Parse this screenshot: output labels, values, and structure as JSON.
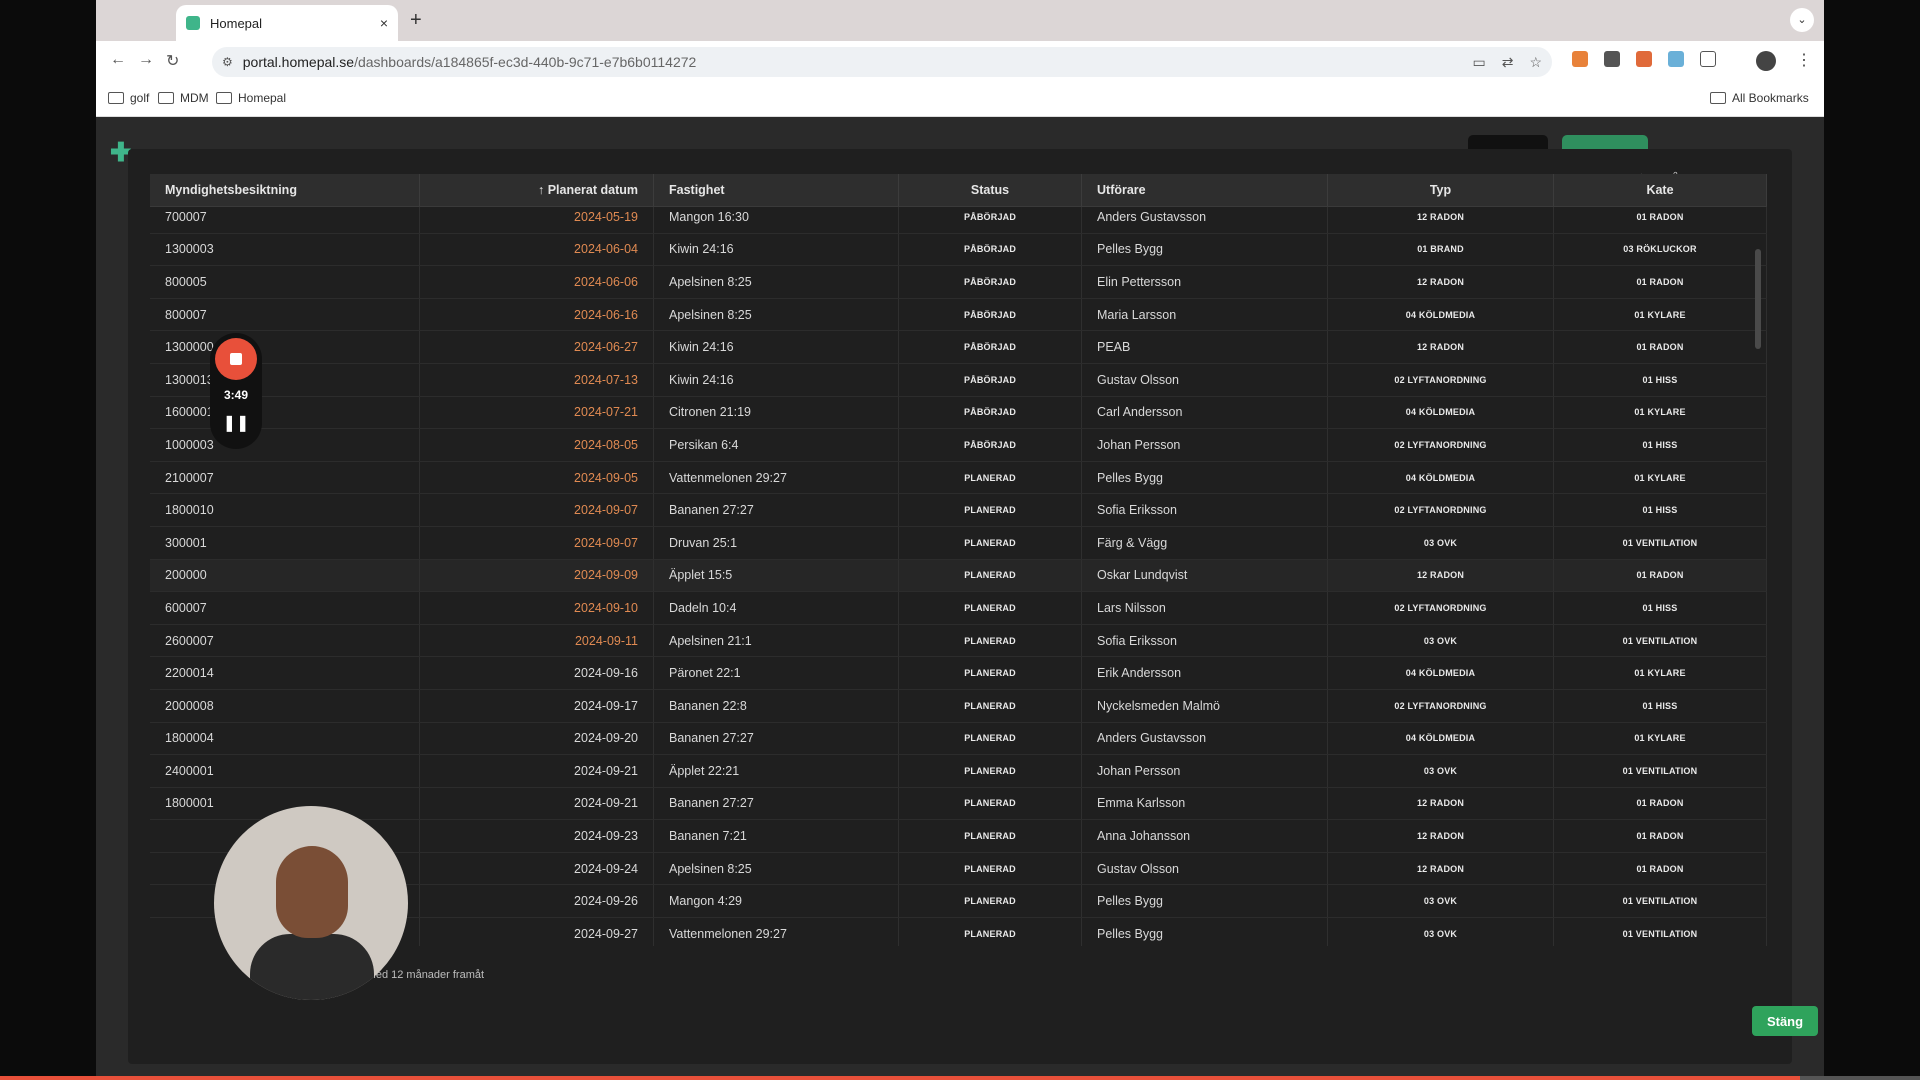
{
  "browser": {
    "tab_title": "Homepal",
    "tab_close": "×",
    "new_tab": "+",
    "url_domain": "portal.homepal.se",
    "url_path": "/dashboards/a184865f-ec3d-440b-9c71-e7b6b0114272",
    "bookmarks": [
      "golf",
      "MDM",
      "Homepal"
    ],
    "all_bookmarks": "All Bookmarks"
  },
  "recorder": {
    "time": "3:49"
  },
  "table": {
    "headers": [
      "Myndighetsbesiktning",
      "Planerat datum",
      "Fastighet",
      "Status",
      "Utförare",
      "Typ",
      "Kate"
    ],
    "sort_arrow": "↑",
    "rows": [
      {
        "id": "700007",
        "date": "2024-05-19",
        "overdue": true,
        "property": "Mangon 16:30",
        "status": "PÅBÖRJAD",
        "contractor": "Anders Gustavsson",
        "type": "12 RADON",
        "cat": "01 RADON"
      },
      {
        "id": "1300003",
        "date": "2024-06-04",
        "overdue": true,
        "property": "Kiwin 24:16",
        "status": "PÅBÖRJAD",
        "contractor": "Pelles Bygg",
        "type": "01 BRAND",
        "cat": "03 RÖKLUCKOR"
      },
      {
        "id": "800005",
        "date": "2024-06-06",
        "overdue": true,
        "property": "Apelsinen 8:25",
        "status": "PÅBÖRJAD",
        "contractor": "Elin Pettersson",
        "type": "12 RADON",
        "cat": "01 RADON"
      },
      {
        "id": "800007",
        "date": "2024-06-16",
        "overdue": true,
        "property": "Apelsinen 8:25",
        "status": "PÅBÖRJAD",
        "contractor": "Maria Larsson",
        "type": "04 KÖLDMEDIA",
        "cat": "01 KYLARE"
      },
      {
        "id": "1300000",
        "date": "2024-06-27",
        "overdue": true,
        "property": "Kiwin 24:16",
        "status": "PÅBÖRJAD",
        "contractor": "PEAB",
        "type": "12 RADON",
        "cat": "01 RADON"
      },
      {
        "id": "1300013",
        "date": "2024-07-13",
        "overdue": true,
        "property": "Kiwin 24:16",
        "status": "PÅBÖRJAD",
        "contractor": "Gustav Olsson",
        "type": "02 LYFTANORDNING",
        "cat": "01 HISS"
      },
      {
        "id": "1600001",
        "date": "2024-07-21",
        "overdue": true,
        "property": "Citronen 21:19",
        "status": "PÅBÖRJAD",
        "contractor": "Carl Andersson",
        "type": "04 KÖLDMEDIA",
        "cat": "01 KYLARE"
      },
      {
        "id": "1000003",
        "date": "2024-08-05",
        "overdue": true,
        "property": "Persikan 6:4",
        "status": "PÅBÖRJAD",
        "contractor": "Johan Persson",
        "type": "02 LYFTANORDNING",
        "cat": "01 HISS"
      },
      {
        "id": "2100007",
        "date": "2024-09-05",
        "overdue": true,
        "property": "Vattenmelonen 29:27",
        "status": "PLANERAD",
        "contractor": "Pelles Bygg",
        "type": "04 KÖLDMEDIA",
        "cat": "01 KYLARE"
      },
      {
        "id": "1800010",
        "date": "2024-09-07",
        "overdue": true,
        "property": "Bananen 27:27",
        "status": "PLANERAD",
        "contractor": "Sofia Eriksson",
        "type": "02 LYFTANORDNING",
        "cat": "01 HISS"
      },
      {
        "id": "300001",
        "date": "2024-09-07",
        "overdue": true,
        "property": "Druvan 25:1",
        "status": "PLANERAD",
        "contractor": "Färg & Vägg",
        "type": "03 OVK",
        "cat": "01 VENTILATION"
      },
      {
        "id": "200000",
        "date": "2024-09-09",
        "overdue": true,
        "property": "Äpplet 15:5",
        "status": "PLANERAD",
        "contractor": "Oskar Lundqvist",
        "type": "12 RADON",
        "cat": "01 RADON"
      },
      {
        "id": "600007",
        "date": "2024-09-10",
        "overdue": true,
        "property": "Dadeln 10:4",
        "status": "PLANERAD",
        "contractor": "Lars Nilsson",
        "type": "02 LYFTANORDNING",
        "cat": "01 HISS"
      },
      {
        "id": "2600007",
        "date": "2024-09-11",
        "overdue": true,
        "property": "Apelsinen 21:1",
        "status": "PLANERAD",
        "contractor": "Sofia Eriksson",
        "type": "03 OVK",
        "cat": "01 VENTILATION"
      },
      {
        "id": "2200014",
        "date": "2024-09-16",
        "overdue": false,
        "property": "Päronet 22:1",
        "status": "PLANERAD",
        "contractor": "Erik Andersson",
        "type": "04 KÖLDMEDIA",
        "cat": "01 KYLARE"
      },
      {
        "id": "2000008",
        "date": "2024-09-17",
        "overdue": false,
        "property": "Bananen 22:8",
        "status": "PLANERAD",
        "contractor": "Nyckelsmeden Malmö",
        "type": "02 LYFTANORDNING",
        "cat": "01 HISS"
      },
      {
        "id": "1800004",
        "date": "2024-09-20",
        "overdue": false,
        "property": "Bananen 27:27",
        "status": "PLANERAD",
        "contractor": "Anders Gustavsson",
        "type": "04 KÖLDMEDIA",
        "cat": "01 KYLARE"
      },
      {
        "id": "2400001",
        "date": "2024-09-21",
        "overdue": false,
        "property": "Äpplet 22:21",
        "status": "PLANERAD",
        "contractor": "Johan Persson",
        "type": "03 OVK",
        "cat": "01 VENTILATION"
      },
      {
        "id": "1800001",
        "date": "2024-09-21",
        "overdue": false,
        "property": "Bananen 27:27",
        "status": "PLANERAD",
        "contractor": "Emma Karlsson",
        "type": "12 RADON",
        "cat": "01 RADON"
      },
      {
        "id": "",
        "date": "2024-09-23",
        "overdue": false,
        "property": "Bananen 7:21",
        "status": "PLANERAD",
        "contractor": "Anna Johansson",
        "type": "12 RADON",
        "cat": "01 RADON"
      },
      {
        "id": "",
        "date": "2024-09-24",
        "overdue": false,
        "property": "Apelsinen 8:25",
        "status": "PLANERAD",
        "contractor": "Gustav Olsson",
        "type": "12 RADON",
        "cat": "01 RADON"
      },
      {
        "id": "",
        "date": "2024-09-26",
        "overdue": false,
        "property": "Mangon 4:29",
        "status": "PLANERAD",
        "contractor": "Pelles Bygg",
        "type": "03 OVK",
        "cat": "01 VENTILATION"
      },
      {
        "id": "",
        "date": "2024-09-27",
        "overdue": false,
        "property": "Vattenmelonen 29:27",
        "status": "PLANERAD",
        "contractor": "Pelles Bygg",
        "type": "03 OVK",
        "cat": "01 VENTILATION"
      }
    ]
  },
  "footnote": "iderna och till och med 12 månader framåt",
  "close_label": "Stäng",
  "colors": {
    "overdue_date": "#e08a52",
    "close_button": "#2fa35c",
    "record": "#e8503a"
  }
}
